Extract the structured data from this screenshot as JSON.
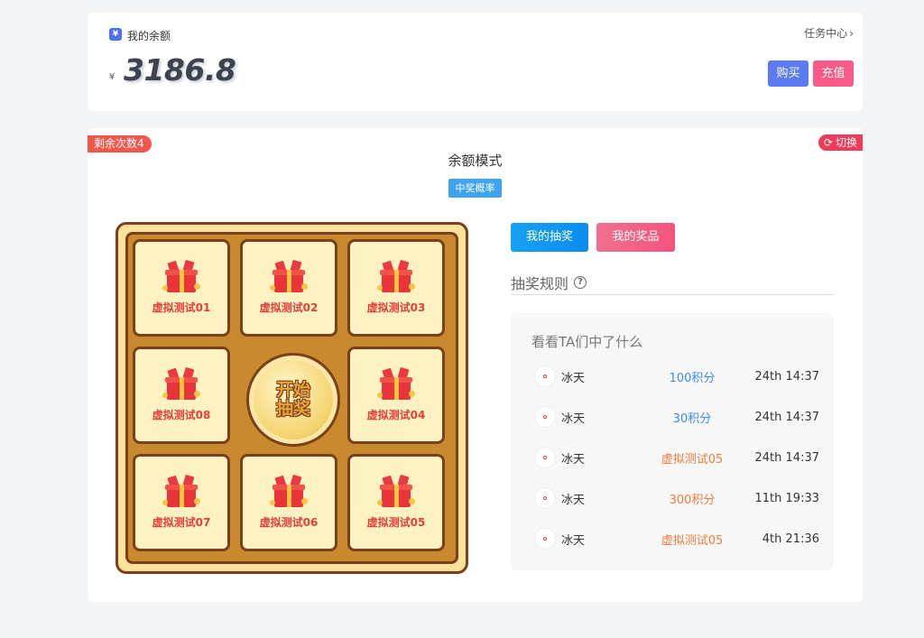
{
  "balance": {
    "title": "我的余额",
    "currency": "¥",
    "amount": "3186.8",
    "task_center": "任务中心",
    "buy_label": "购买",
    "topup_label": "充值"
  },
  "lottery": {
    "remaining": "剩余次数4",
    "switch_label": "切换",
    "mode_title": "余额模式",
    "probability_tag": "中奖概率",
    "start_label_line1": "开始",
    "start_label_line2": "抽奖",
    "cells": [
      {
        "label": "虚拟测试01"
      },
      {
        "label": "虚拟测试02"
      },
      {
        "label": "虚拟测试03"
      },
      {
        "label": "虚拟测试08"
      },
      {
        "label": "虚拟测试04"
      },
      {
        "label": "虚拟测试07"
      },
      {
        "label": "虚拟测试06"
      },
      {
        "label": "虚拟测试05"
      }
    ]
  },
  "panel": {
    "tab_my_draws": "我的抽奖",
    "tab_my_prizes": "我的奖品",
    "rules_label": "抽奖规则",
    "winners_title": "看看TA们中了什么",
    "winners": [
      {
        "name": "冰天",
        "prize": "100积分",
        "time": "24th 14:37",
        "prize_color": "#3b8ee8"
      },
      {
        "name": "冰天",
        "prize": "30积分",
        "time": "24th 14:37",
        "prize_color": "#3b8ee8"
      },
      {
        "name": "冰天",
        "prize": "虚拟测试05",
        "time": "24th 14:37",
        "prize_color": "#f07b3a"
      },
      {
        "name": "冰天",
        "prize": "300积分",
        "time": "11th 19:33",
        "prize_color": "#f07b3a"
      },
      {
        "name": "冰天",
        "prize": "虚拟测试05",
        "time": "4th 21:36",
        "prize_color": "#f07b3a"
      }
    ]
  },
  "colors": {
    "accent_blue": "#5b7bf2",
    "accent_pink": "#f95a87",
    "badge_red": "#f2574b",
    "board_brown": "#7a3f1c"
  }
}
